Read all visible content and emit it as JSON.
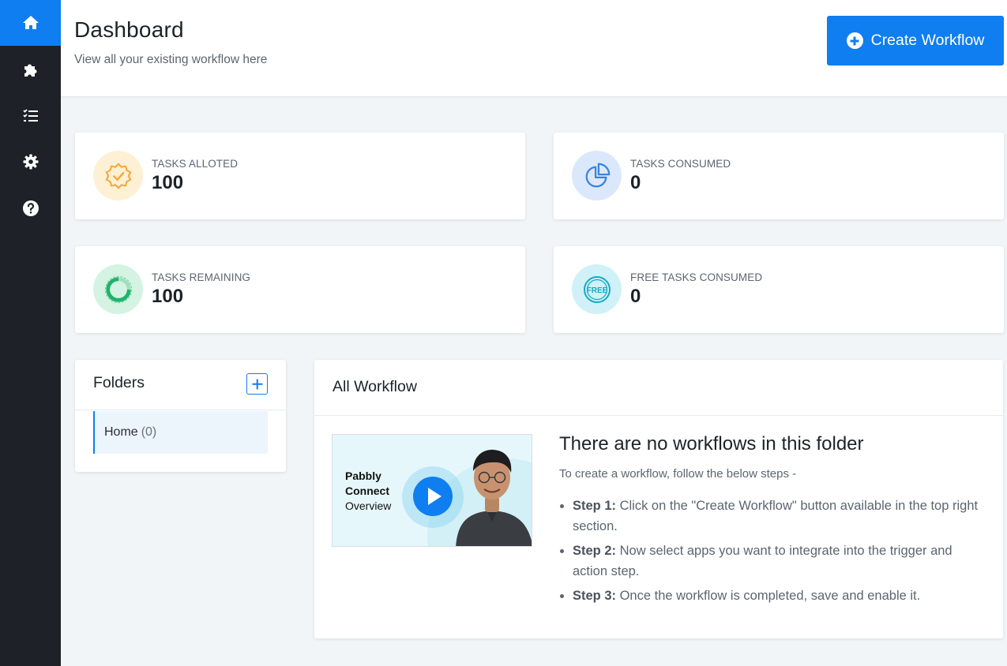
{
  "sidebar": {
    "items": [
      {
        "icon": "home-icon",
        "active": true
      },
      {
        "icon": "puzzle-icon",
        "active": false
      },
      {
        "icon": "task-list-icon",
        "active": false
      },
      {
        "icon": "gear-icon",
        "active": false
      },
      {
        "icon": "help-icon",
        "active": false
      }
    ]
  },
  "header": {
    "title": "Dashboard",
    "subtitle": "View all your existing workflow here",
    "create_button": "Create Workflow"
  },
  "stats": [
    {
      "label": "TASKS ALLOTED",
      "value": "100",
      "icon": "badge-check-icon",
      "color": "#f2a93b"
    },
    {
      "label": "TASKS CONSUMED",
      "value": "0",
      "icon": "pie-chart-icon",
      "color": "#3d82e0"
    },
    {
      "label": "TASKS REMAINING",
      "value": "100",
      "icon": "donut-icon",
      "color": "#1fb36b"
    },
    {
      "label": "FREE TASKS CONSUMED",
      "value": "0",
      "icon": "free-icon",
      "color": "#17a9c2"
    }
  ],
  "folders": {
    "title": "Folders",
    "items": [
      {
        "name": "Home",
        "count": "(0)"
      }
    ]
  },
  "workflow": {
    "title": "All Workflow",
    "video": {
      "line1": "Pabbly",
      "line2": "Connect",
      "line3": "Overview"
    },
    "empty_title": "There are no workflows in this folder",
    "empty_sub": "To create a workflow, follow the below steps -",
    "steps": [
      {
        "label": "Step 1:",
        "text": " Click on the \"Create Workflow\" button available in the top right section."
      },
      {
        "label": "Step 2:",
        "text": " Now select apps you want to integrate into the trigger and action step."
      },
      {
        "label": "Step 3:",
        "text": " Once the workflow is completed, save and enable it."
      }
    ]
  },
  "colors": {
    "accent": "#0f7ef0",
    "sidebar_bg": "#1e2228",
    "page_bg": "#f2f5f8"
  }
}
